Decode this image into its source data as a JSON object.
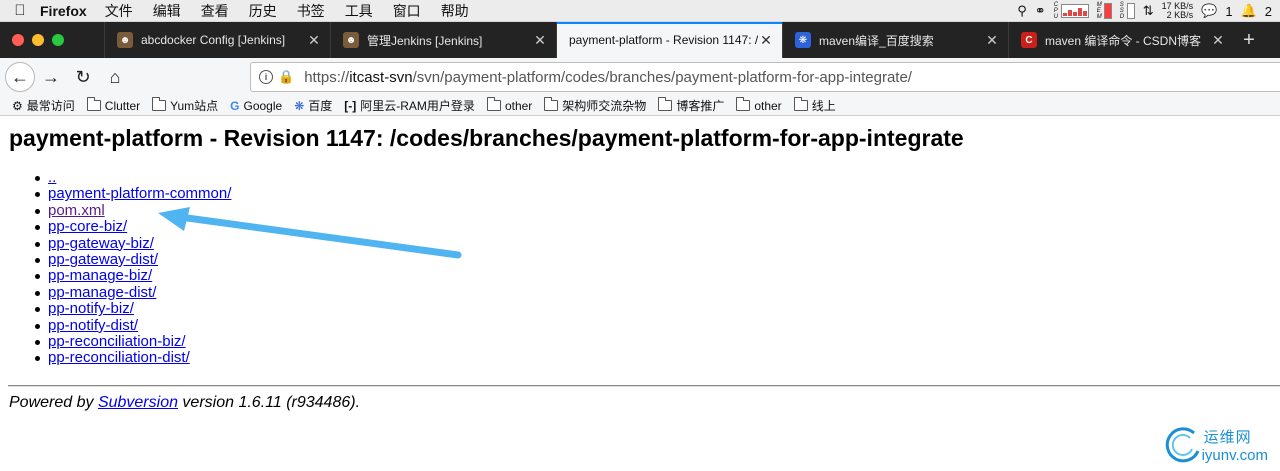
{
  "menubar": {
    "app_name": "Firefox",
    "items": [
      "文件",
      "编辑",
      "查看",
      "历史",
      "书签",
      "工具",
      "窗口",
      "帮助"
    ],
    "status": {
      "net_up": "17 KB/s",
      "net_down": "2 KB/s",
      "wechat_count": "1",
      "notify_count": "2"
    }
  },
  "tabs": [
    {
      "title": "abcdocker Config [Jenkins]",
      "icon": "jenkins-icon",
      "active": false
    },
    {
      "title": "管理Jenkins [Jenkins]",
      "icon": "jenkins-icon",
      "active": false
    },
    {
      "title": "payment-platform - Revision 1147: /",
      "icon": "",
      "active": true
    },
    {
      "title": "maven编译_百度搜索",
      "icon": "baidu-icon",
      "active": false
    },
    {
      "title": "maven 编译命令 - CSDN博客",
      "icon": "csdn-icon",
      "active": false
    }
  ],
  "url": {
    "scheme": "https://",
    "host": "itcast-svn",
    "path": "/svn/payment-platform/codes/branches/payment-platform-for-app-integrate/"
  },
  "bookmarks": [
    {
      "label": "最常访问",
      "icon": "gear-icon"
    },
    {
      "label": "Clutter",
      "icon": "folder-icon"
    },
    {
      "label": "Yum站点",
      "icon": "folder-icon"
    },
    {
      "label": "Google",
      "icon": "google-icon"
    },
    {
      "label": "百度",
      "icon": "baidu-icon"
    },
    {
      "label": "阿里云-RAM用户登录",
      "icon": "aliyun-icon"
    },
    {
      "label": "other",
      "icon": "folder-icon"
    },
    {
      "label": "架构师交流杂物",
      "icon": "folder-icon"
    },
    {
      "label": "博客推广",
      "icon": "folder-icon"
    },
    {
      "label": "other",
      "icon": "folder-icon"
    },
    {
      "label": "线上",
      "icon": "folder-icon"
    }
  ],
  "page": {
    "title": "payment-platform - Revision 1147: /codes/branches/payment-platform-for-app-integrate",
    "entries": [
      {
        "label": "..",
        "visited": false
      },
      {
        "label": "payment-platform-common/",
        "visited": false
      },
      {
        "label": "pom.xml",
        "visited": true
      },
      {
        "label": "pp-core-biz/",
        "visited": false
      },
      {
        "label": "pp-gateway-biz/",
        "visited": false
      },
      {
        "label": "pp-gateway-dist/",
        "visited": false
      },
      {
        "label": "pp-manage-biz/",
        "visited": false
      },
      {
        "label": "pp-manage-dist/",
        "visited": false
      },
      {
        "label": "pp-notify-biz/",
        "visited": false
      },
      {
        "label": "pp-notify-dist/",
        "visited": false
      },
      {
        "label": "pp-reconciliation-biz/",
        "visited": false
      },
      {
        "label": "pp-reconciliation-dist/",
        "visited": false
      }
    ],
    "footer": {
      "prefix": "Powered by ",
      "link": "Subversion",
      "suffix": " version 1.6.11 (r934486)."
    }
  },
  "watermark": {
    "cn": "运维网",
    "url": "iyunv.com"
  },
  "colors": {
    "link": "#0000ee",
    "visited": "#551a8b",
    "annotation_arrow": "#4fb4ef",
    "tab_active_accent": "#0a84ff"
  }
}
